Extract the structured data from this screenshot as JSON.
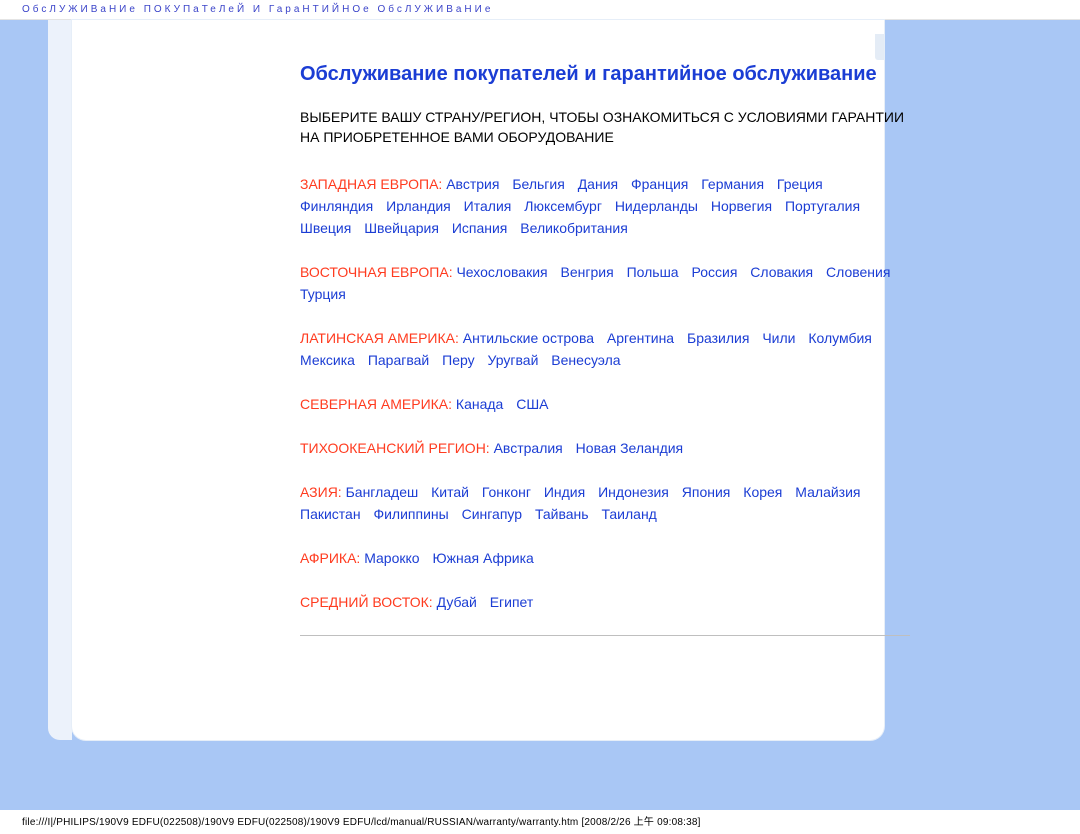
{
  "header_bar": "ОбсЛУЖИВаНИе ПОКУПаТеЛеЙ И ГараНТИЙНОе ОбсЛУЖИВаНИе",
  "title": "Обслуживание покупателей и гарантийное обслуживание",
  "intro": "ВЫБЕРИТЕ ВАШУ СТРАНУ/РЕГИОН, ЧТОБЫ ОЗНАКОМИТЬСЯ С УСЛОВИЯМИ ГАРАНТИИ НА ПРИОБРЕТЕННОЕ ВАМИ ОБОРУДОВАНИЕ",
  "regions": [
    {
      "label": "ЗАПАДНАЯ ЕВРОПА:",
      "countries": [
        "Австрия",
        "Бельгия",
        "Дания",
        "Франция",
        "Германия",
        "Греция",
        "Финляндия",
        "Ирландия",
        "Италия",
        "Люксембург",
        "Нидерланды",
        "Норвегия",
        "Португалия",
        "Швеция",
        "Швейцария",
        "Испания",
        "Великобритания"
      ]
    },
    {
      "label": "ВОСТОЧНАЯ ЕВРОПА:",
      "countries": [
        "Чехословакия",
        "Венгрия",
        "Польша",
        "Россия",
        "Словакия",
        "Словения",
        "Турция"
      ]
    },
    {
      "label": "ЛАТИНСКАЯ АМЕРИКА:",
      "countries": [
        "Антильские острова",
        "Аргентина",
        "Бразилия",
        "Чили",
        "Колумбия",
        "Мексика",
        "Парагвай",
        "Перу",
        "Уругвай",
        "Венесуэла"
      ]
    },
    {
      "label": "СЕВЕРНАЯ АМЕРИКА:",
      "countries": [
        "Канада",
        "США"
      ]
    },
    {
      "label": "ТИХООКЕАНСКИЙ РЕГИОН:",
      "countries": [
        "Австралия",
        "Новая Зеландия"
      ]
    },
    {
      "label": "АЗИЯ:",
      "countries": [
        "Бангладеш",
        "Китай",
        "Гонконг",
        "Индия",
        "Индонезия",
        "Япония",
        "Корея",
        "Малайзия",
        "Пакистан",
        "Филиппины",
        "Сингапур",
        "Тайвань",
        "Таиланд"
      ]
    },
    {
      "label": "АФРИКА:",
      "countries": [
        "Марокко",
        "Южная Африка"
      ]
    },
    {
      "label": "СРЕДНИЙ ВОСТОК:",
      "countries": [
        "Дубай",
        "Египет"
      ]
    }
  ],
  "footer_path": "file:///I|/PHILIPS/190V9 EDFU(022508)/190V9 EDFU(022508)/190V9 EDFU/lcd/manual/RUSSIAN/warranty/warranty.htm [2008/2/26 上午 09:08:38]"
}
